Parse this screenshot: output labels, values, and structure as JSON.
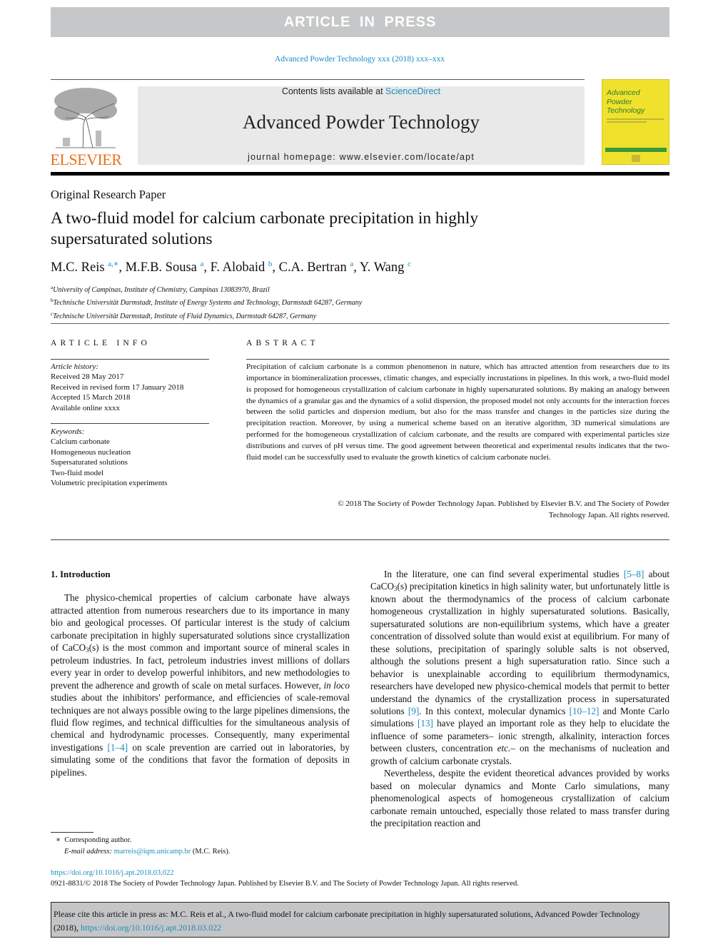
{
  "banner": {
    "text": "ARTICLE IN PRESS"
  },
  "journal_ref": "Advanced Powder Technology xxx (2018) xxx–xxx",
  "masthead": {
    "contents_prefix": "Contents lists available at ",
    "contents_link": "ScienceDirect",
    "journal_title": "Advanced Powder Technology",
    "homepage": "journal homepage: www.elsevier.com/locate/apt",
    "publisher_logo_text": "ELSEVIER",
    "cover_title_lines": [
      "Advanced",
      "Powder",
      "Technology"
    ]
  },
  "paper": {
    "type": "Original Research Paper",
    "title": "A two-fluid model for calcium carbonate precipitation in highly supersaturated solutions",
    "authors": [
      {
        "name": "M.C. Reis",
        "sup": "a,",
        "star": "∗"
      },
      {
        "name": "M.F.B. Sousa",
        "sup": "a"
      },
      {
        "name": "F. Alobaid",
        "sup": "b"
      },
      {
        "name": "C.A. Bertran",
        "sup": "a"
      },
      {
        "name": "Y. Wang",
        "sup": "c"
      }
    ],
    "affiliations": [
      {
        "mark": "a",
        "text": "University of Campinas, Institute of Chemistry, Campinas 13083970, Brazil"
      },
      {
        "mark": "b",
        "text": "Technische Universität Darmstadt, Institute of Energy Systems and Technology, Darmstadt 64287, Germany"
      },
      {
        "mark": "c",
        "text": "Technische Universität Darmstadt, Institute of Fluid Dynamics, Darmstadt 64287, Germany"
      }
    ]
  },
  "article_info": {
    "heading": "ARTICLE INFO",
    "history_label": "Article history:",
    "history": [
      "Received 28 May 2017",
      "Received in revised form 17 January 2018",
      "Accepted 15 March 2018",
      "Available online xxxx"
    ],
    "keywords_label": "Keywords:",
    "keywords": [
      "Calcium carbonate",
      "Homogeneous nucleation",
      "Supersaturated solutions",
      "Two-fluid model",
      "Volumetric precipitation experiments"
    ]
  },
  "abstract": {
    "heading": "ABSTRACT",
    "text": "Precipitation of calcium carbonate is a common phenomenon in nature, which has attracted attention from researchers due to its importance in biomineralization processes, climatic changes, and especially incrustations in pipelines. In this work, a two-fluid model is proposed for homogeneous crystallization of calcium carbonate in highly supersaturated solutions. By making an analogy between the dynamics of a granular gas and the dynamics of a solid dispersion, the proposed model not only accounts for the interaction forces between the solid particles and dispersion medium, but also for the mass transfer and changes in the particles size during the precipitation reaction. Moreover, by using a numerical scheme based on an iterative algorithm, 3D numerical simulations are performed for the homogeneous crystallization of calcium carbonate, and the results are compared with experimental particles size dis­tributions and curves of pH versus time. The good agreement between theoretical and experimental results indicates that the two-fluid model can be successfully used to evaluate the growth kinetics of cal­cium carbonate nuclei.",
    "copyright_line1": "© 2018 The Society of Powder Technology Japan. Published by Elsevier B.V. and The Society of Powder",
    "copyright_line2": "Technology Japan. All rights reserved."
  },
  "body": {
    "intro_heading": "1. Introduction",
    "left_p1_a": "The physico-chemical properties of calcium carbonate have always attracted attention from numerous researchers due to its importance in many bio and geological processes. Of particular interest is the study of calcium carbonate precipitation in highly supersaturated solutions since crystallization of CaCO",
    "left_p1_sub": "3",
    "left_p1_b": "(s) is the most common and important source of mineral scales in petro­leum industries. In fact, petroleum industries invest millions of dollars every year in order to develop powerful inhibitors, and new methodologies to prevent the adherence and growth of scale on metal surfaces. However, ",
    "left_p1_italic": "in loco",
    "left_p1_c": " studies about the inhibitors' performance, and efficiencies of scale-removal techniques are not always possible owing to the large pipelines dimensions, the fluid flow regimes, and technical difficulties for the simultaneous anal­ysis of chemical and hydrodynamic processes. Consequently, many experimental investigations ",
    "left_p1_ref": "[1–4]",
    "left_p1_d": " on scale prevention are carried out in laboratories, by simulating some of the conditions that favor the formation of deposits in pipelines.",
    "right_p1_a": "In the literature, one can find several experimental studies ",
    "right_p1_ref1": "[5–8]",
    "right_p1_b": " about CaCO",
    "right_p1_sub": "3",
    "right_p1_c": "(s) precipitation kinetics in high salinity water, but unfortunately little is known about the thermodynamics of the pro­cess of calcium carbonate homogeneous crystallization in highly supersaturated solutions. Basically, supersaturated solutions are non-equilibrium systems, which have a greater concentration of dissolved solute than would exist at equilibrium. For many of these solutions, precipitation of sparingly soluble salts is not observed, although the solutions present a high supersaturation ratio. Since such a behavior is unexplainable according to equilibrium thermo­dynamics, researchers have developed new physico-chemical mod­els that permit to better understand the dynamics of the crystallization process in supersaturated solutions ",
    "right_p1_ref2": "[9]",
    "right_p1_d": ". In this con­text, molecular dynamics ",
    "right_p1_ref3": "[10–12]",
    "right_p1_e": " and Monte Carlo simulations ",
    "right_p1_ref4": "[13]",
    "right_p1_f": " have played an important role as they help to elucidate the influence of some parameters– ionic strength, alkalinity, interac­tion forces between clusters, concentration ",
    "right_p1_italic": "etc.",
    "right_p1_g": "– on the mecha­nisms of nucleation and growth of calcium carbonate crystals.",
    "right_p2": "Nevertheless, despite the evident theoretical advances provided by works based on molecular dynamics and Monte Carlo simula­tions, many phenomenological aspects of homogeneous crystal­lization of calcium carbonate remain untouched, especially those related to mass transfer during the precipitation reaction and"
  },
  "footnote": {
    "star": "∗",
    "corresponding": "Corresponding author.",
    "email_label": "E-mail address:",
    "email": "marreis@iqm.unicamp.br",
    "email_suffix": " (M.C. Reis)."
  },
  "doi": {
    "link": "https://doi.org/10.1016/j.apt.2018.03.022",
    "issn_line": "0921-8831/© 2018 The Society of Powder Technology Japan. Published by Elsevier B.V. and The Society of Powder Technology Japan. All rights reserved."
  },
  "citation": {
    "text": "Please cite this article in press as: M.C. Reis et al., A two-fluid model for calcium carbonate precipitation in highly supersaturated solutions, Advanced Powder Technology (2018), ",
    "link": "https://doi.org/10.1016/j.apt.2018.03.022"
  }
}
